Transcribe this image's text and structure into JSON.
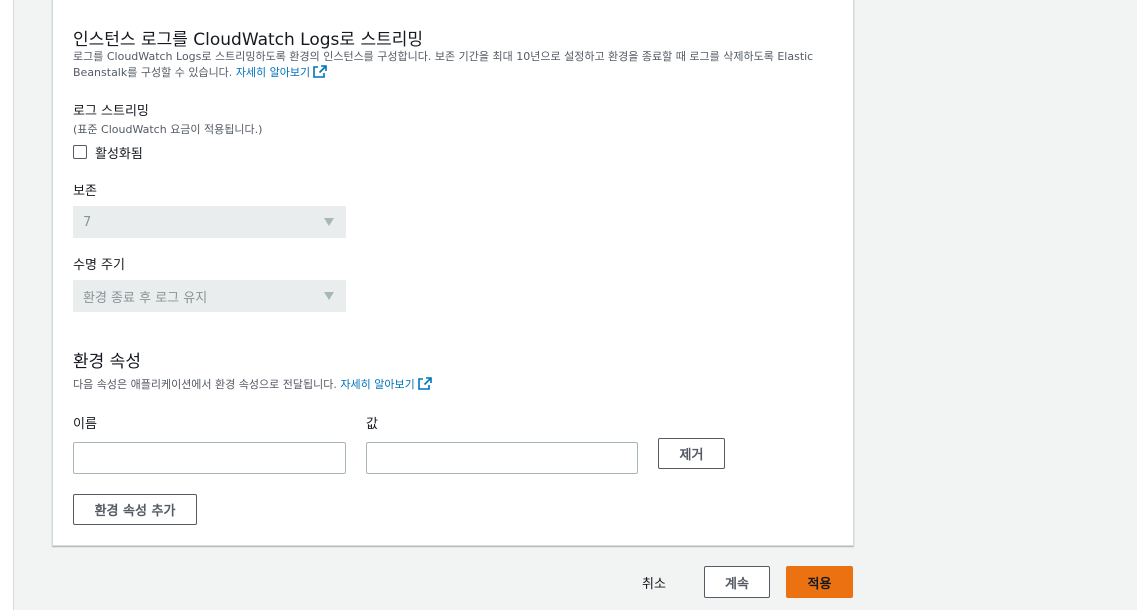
{
  "log_streaming": {
    "title": "인스턴스 로그를 CloudWatch Logs로 스트리밍",
    "description": "로그를 CloudWatch Logs로 스트리밍하도록 환경의 인스턴스를 구성합니다. 보존 기간을 최대 10년으로 설정하고 환경을 종료할 때 로그를 삭제하도록 Elastic Beanstalk를 구성할 수 있습니다.",
    "learn_more": "자세히 알아보기",
    "field_label": "로그 스트리밍",
    "field_sublabel": "(표준 CloudWatch 요금이 적용됩니다.)",
    "checkbox_label": "활성화됨",
    "retention_label": "보존",
    "retention_value": "7",
    "lifecycle_label": "수명 주기",
    "lifecycle_value": "환경 종료 후 로그 유지"
  },
  "env_properties": {
    "title": "환경 속성",
    "description": "다음 속성은 애플리케이션에서 환경 속성으로 전달됩니다.",
    "learn_more": "자세히 알아보기",
    "name_label": "이름",
    "value_label": "값",
    "name_value": "",
    "value_value": "",
    "remove_button": "제거",
    "add_button": "환경 속성 추가"
  },
  "footer": {
    "cancel": "취소",
    "continue": "계속",
    "apply": "적용"
  },
  "colors": {
    "primary": "#ec7211",
    "link": "#0073bb",
    "background": "#f2f3f3"
  }
}
